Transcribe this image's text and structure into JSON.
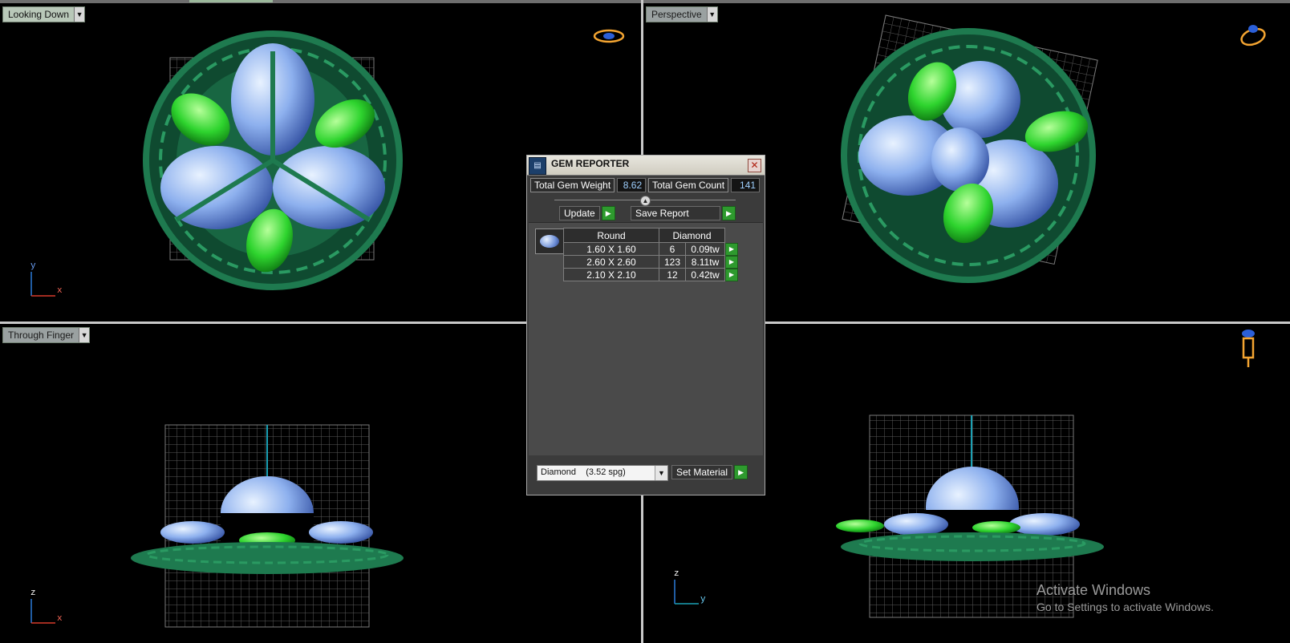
{
  "viewports": [
    {
      "label": "Looking Down",
      "axes": [
        "y",
        "x"
      ]
    },
    {
      "label": "Perspective",
      "axes": []
    },
    {
      "label": "Through Finger",
      "axes": [
        "z",
        "x"
      ]
    },
    {
      "label": "",
      "axes": [
        "z",
        "y"
      ]
    }
  ],
  "icons": {
    "top_left_gizmo": "ring-orientation-icon",
    "top_right_gizmo": "ring-perspective-icon",
    "bottom_right_gizmo": "ring-side-icon",
    "dialog": "gem-reporter-icon"
  },
  "colors": {
    "metal": "#1e7a4f",
    "gems": "#8db0ee",
    "leaves": "#2ed42e",
    "grid": "#5a5a5a"
  },
  "gem_reporter": {
    "title": "GEM REPORTER",
    "close_symbol": "✕",
    "total_weight_label": "Total Gem Weight",
    "total_weight_value": "8.62",
    "total_count_label": "Total Gem Count",
    "total_count_value": "141",
    "update_label": "Update",
    "save_report_label": "Save Report",
    "table_headers": {
      "shape": "Round",
      "material": "Diamond"
    },
    "rows": [
      {
        "size": "1.60 X 1.60",
        "count": "6",
        "weight": "0.09tw"
      },
      {
        "size": "2.60 X 2.60",
        "count": "123",
        "weight": "8.11tw"
      },
      {
        "size": "2.10 X 2.10",
        "count": "12",
        "weight": "0.42tw"
      }
    ],
    "material_value": "Diamond    (3.52 spg)",
    "set_material_label": "Set Material"
  },
  "watermark": {
    "line1": "Activate Windows",
    "line2": "Go to Settings to activate Windows."
  }
}
